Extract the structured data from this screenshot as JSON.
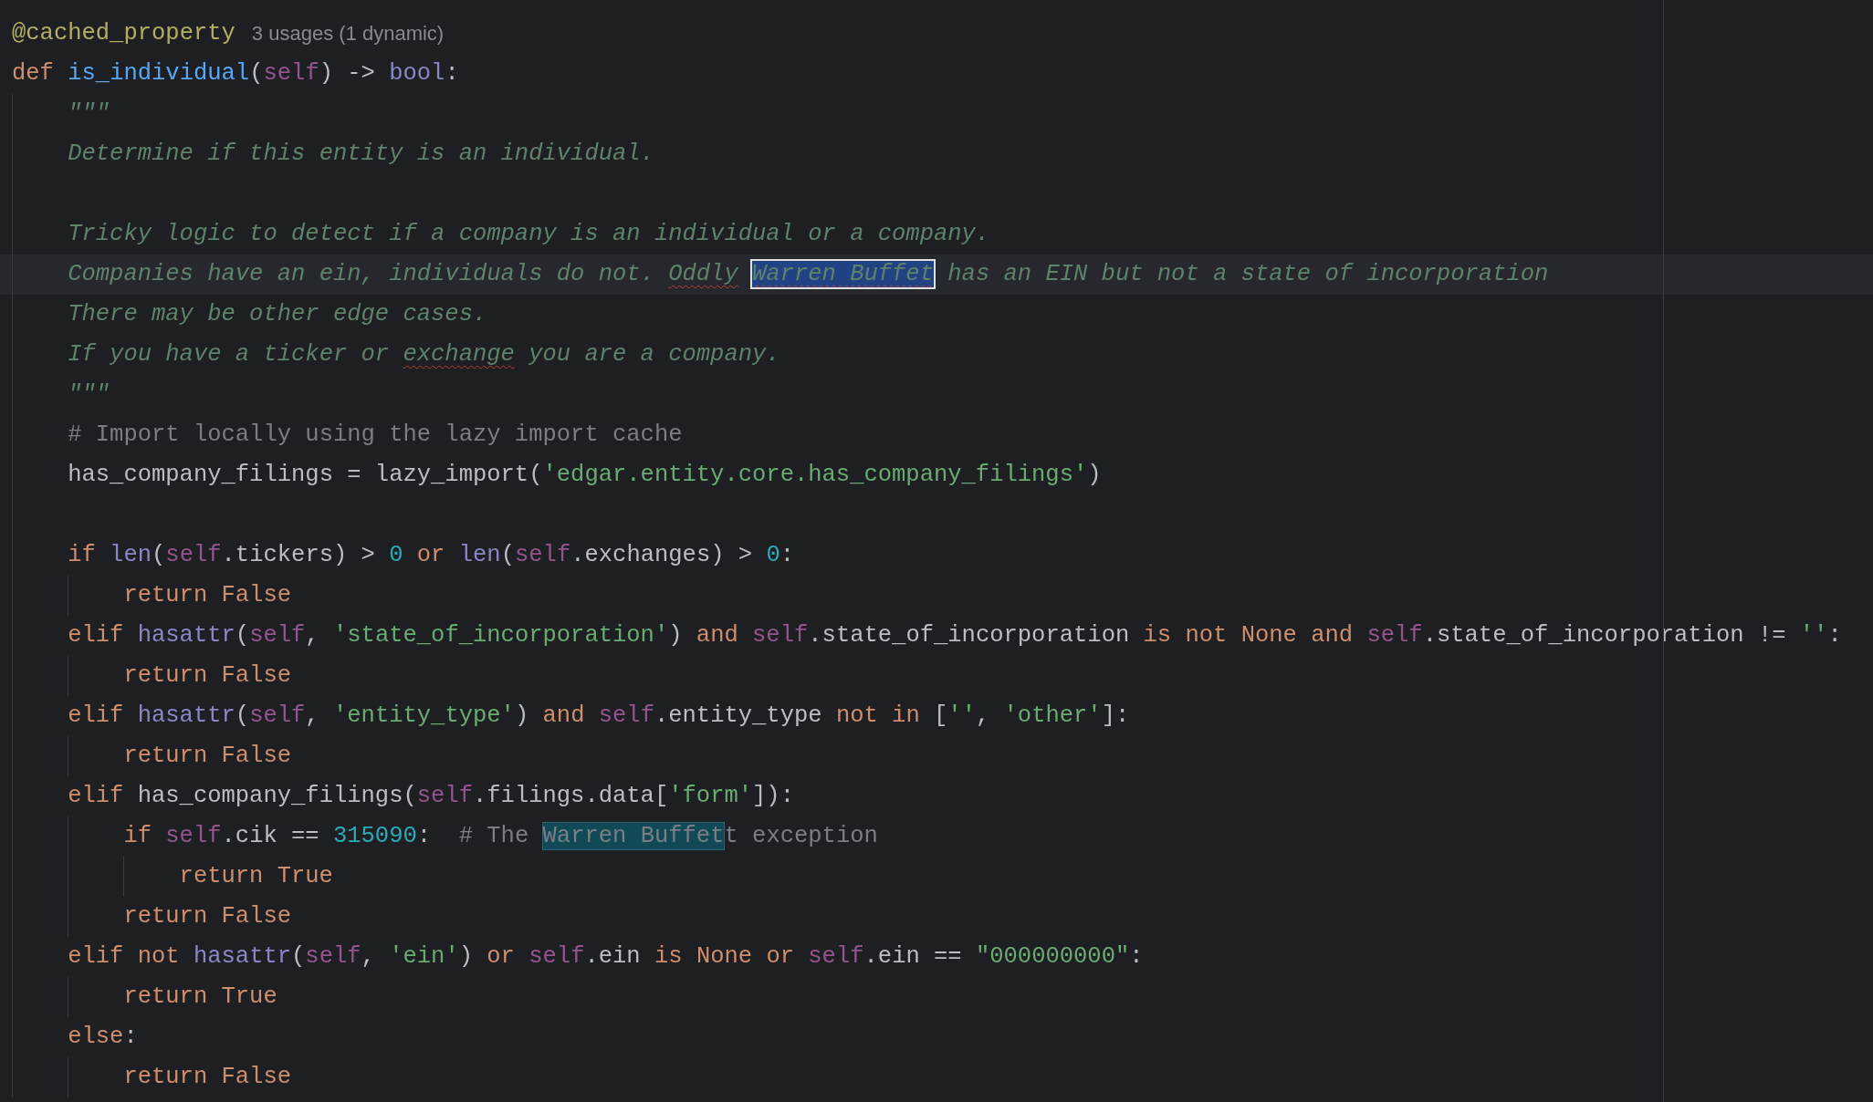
{
  "editor": {
    "lines": [
      {
        "current": false,
        "tokens": [
          {
            "kind": "decorator",
            "text": "@cached_property"
          },
          {
            "kind": "hint",
            "text": "3 usages (1 dynamic)"
          }
        ]
      },
      {
        "current": false,
        "tokens": [
          {
            "kind": "keyword",
            "text": "def "
          },
          {
            "kind": "func",
            "text": "is_individual"
          },
          {
            "kind": "plain",
            "text": "("
          },
          {
            "kind": "self",
            "text": "self"
          },
          {
            "kind": "plain",
            "text": ") -> "
          },
          {
            "kind": "builtin",
            "text": "bool"
          },
          {
            "kind": "plain",
            "text": ":"
          }
        ]
      },
      {
        "current": false,
        "tokens": [
          {
            "kind": "doc",
            "text": "    \"\"\""
          }
        ]
      },
      {
        "current": false,
        "tokens": [
          {
            "kind": "doc",
            "text": "    Determine if this entity is an individual."
          }
        ]
      },
      {
        "current": false
      },
      {
        "current": false,
        "tokens": [
          {
            "kind": "doc",
            "text": "    Tricky logic to detect if a company is an individual or a company."
          }
        ]
      },
      {
        "current": true,
        "tokens": [
          {
            "kind": "doc",
            "text": "    Companies have an ein, individuals do not. "
          },
          {
            "kind": "doc_typo",
            "text": "Oddly "
          },
          {
            "kind": "doc_selected",
            "text": "Warren Buffet"
          },
          {
            "kind": "doc",
            "text": " has an EIN but not a state of incorporation"
          }
        ]
      },
      {
        "current": false,
        "tokens": [
          {
            "kind": "doc",
            "text": "    There may be other edge cases."
          }
        ]
      },
      {
        "current": false,
        "tokens": [
          {
            "kind": "doc",
            "text": "    If you have a ticker or "
          },
          {
            "kind": "doc_typo",
            "text": "exchange"
          },
          {
            "kind": "doc",
            "text": " you are a company."
          }
        ]
      },
      {
        "current": false,
        "tokens": [
          {
            "kind": "doc",
            "text": "    \"\"\""
          }
        ]
      },
      {
        "current": false,
        "tokens": [
          {
            "kind": "comment",
            "text": "    # Import locally using the lazy import cache"
          }
        ]
      },
      {
        "current": false,
        "tokens": [
          {
            "kind": "plain",
            "text": "    has_company_filings = lazy_import("
          },
          {
            "kind": "string",
            "text": "'edgar.entity.core.has_company_filings'"
          },
          {
            "kind": "plain",
            "text": ")"
          }
        ]
      },
      {
        "current": false
      },
      {
        "current": false,
        "tokens": [
          {
            "kind": "keyword",
            "text": "    if "
          },
          {
            "kind": "builtin",
            "text": "len"
          },
          {
            "kind": "plain",
            "text": "("
          },
          {
            "kind": "self",
            "text": "self"
          },
          {
            "kind": "plain",
            "text": ".tickers) > "
          },
          {
            "kind": "number",
            "text": "0"
          },
          {
            "kind": "keyword",
            "text": " or "
          },
          {
            "kind": "builtin",
            "text": "len"
          },
          {
            "kind": "plain",
            "text": "("
          },
          {
            "kind": "self",
            "text": "self"
          },
          {
            "kind": "plain",
            "text": ".exchanges) > "
          },
          {
            "kind": "number",
            "text": "0"
          },
          {
            "kind": "plain",
            "text": ":"
          }
        ]
      },
      {
        "current": false,
        "tokens": [
          {
            "kind": "keyword",
            "text": "        return False"
          }
        ]
      },
      {
        "current": false,
        "tokens": [
          {
            "kind": "keyword",
            "text": "    elif "
          },
          {
            "kind": "builtin",
            "text": "hasattr"
          },
          {
            "kind": "plain",
            "text": "("
          },
          {
            "kind": "self",
            "text": "self"
          },
          {
            "kind": "plain",
            "text": ", "
          },
          {
            "kind": "string",
            "text": "'state_of_incorporation'"
          },
          {
            "kind": "plain",
            "text": ")"
          },
          {
            "kind": "keyword",
            "text": " and "
          },
          {
            "kind": "self",
            "text": "self"
          },
          {
            "kind": "plain",
            "text": ".state_of_incorporation"
          },
          {
            "kind": "keyword",
            "text": " is not None and "
          },
          {
            "kind": "self",
            "text": "self"
          },
          {
            "kind": "plain",
            "text": ".state_of_incorporation != "
          },
          {
            "kind": "string",
            "text": "''"
          },
          {
            "kind": "plain",
            "text": ":"
          }
        ]
      },
      {
        "current": false,
        "tokens": [
          {
            "kind": "keyword",
            "text": "        return False"
          }
        ]
      },
      {
        "current": false,
        "tokens": [
          {
            "kind": "keyword",
            "text": "    elif "
          },
          {
            "kind": "builtin",
            "text": "hasattr"
          },
          {
            "kind": "plain",
            "text": "("
          },
          {
            "kind": "self",
            "text": "self"
          },
          {
            "kind": "plain",
            "text": ", "
          },
          {
            "kind": "string",
            "text": "'entity_type'"
          },
          {
            "kind": "plain",
            "text": ")"
          },
          {
            "kind": "keyword",
            "text": " and "
          },
          {
            "kind": "self",
            "text": "self"
          },
          {
            "kind": "plain",
            "text": ".entity_type"
          },
          {
            "kind": "keyword",
            "text": " not in "
          },
          {
            "kind": "plain",
            "text": "["
          },
          {
            "kind": "string",
            "text": "''"
          },
          {
            "kind": "plain",
            "text": ", "
          },
          {
            "kind": "string",
            "text": "'other'"
          },
          {
            "kind": "plain",
            "text": "]:"
          }
        ]
      },
      {
        "current": false,
        "tokens": [
          {
            "kind": "keyword",
            "text": "        return False"
          }
        ]
      },
      {
        "current": false,
        "tokens": [
          {
            "kind": "keyword",
            "text": "    elif "
          },
          {
            "kind": "plain",
            "text": "has_company_filings("
          },
          {
            "kind": "self",
            "text": "self"
          },
          {
            "kind": "plain",
            "text": ".filings.data["
          },
          {
            "kind": "string",
            "text": "'form'"
          },
          {
            "kind": "plain",
            "text": "]):"
          }
        ]
      },
      {
        "current": false,
        "tokens": [
          {
            "kind": "keyword",
            "text": "        if "
          },
          {
            "kind": "self",
            "text": "self"
          },
          {
            "kind": "plain",
            "text": ".cik == "
          },
          {
            "kind": "number",
            "text": "315090"
          },
          {
            "kind": "plain",
            "text": ":  "
          },
          {
            "kind": "comment",
            "text": "# The "
          },
          {
            "kind": "comment_match",
            "text": "Warren Buffet"
          },
          {
            "kind": "comment",
            "text": "t exception"
          }
        ]
      },
      {
        "current": false,
        "tokens": [
          {
            "kind": "keyword",
            "text": "            return True"
          }
        ]
      },
      {
        "current": false,
        "tokens": [
          {
            "kind": "keyword",
            "text": "        return False"
          }
        ]
      },
      {
        "current": false,
        "tokens": [
          {
            "kind": "keyword",
            "text": "    elif not "
          },
          {
            "kind": "builtin",
            "text": "hasattr"
          },
          {
            "kind": "plain",
            "text": "("
          },
          {
            "kind": "self",
            "text": "self"
          },
          {
            "kind": "plain",
            "text": ", "
          },
          {
            "kind": "string",
            "text": "'ein'"
          },
          {
            "kind": "plain",
            "text": ")"
          },
          {
            "kind": "keyword",
            "text": " or "
          },
          {
            "kind": "self",
            "text": "self"
          },
          {
            "kind": "plain",
            "text": ".ein"
          },
          {
            "kind": "keyword",
            "text": " is None or "
          },
          {
            "kind": "self",
            "text": "self"
          },
          {
            "kind": "plain",
            "text": ".ein == "
          },
          {
            "kind": "string",
            "text": "\"000000000\""
          },
          {
            "kind": "plain",
            "text": ":"
          }
        ]
      },
      {
        "current": false,
        "tokens": [
          {
            "kind": "keyword",
            "text": "        return True"
          }
        ]
      },
      {
        "current": false,
        "tokens": [
          {
            "kind": "keyword",
            "text": "    else"
          },
          {
            "kind": "plain",
            "text": ":"
          }
        ]
      },
      {
        "current": false,
        "tokens": [
          {
            "kind": "keyword",
            "text": "        return False"
          }
        ]
      }
    ]
  }
}
